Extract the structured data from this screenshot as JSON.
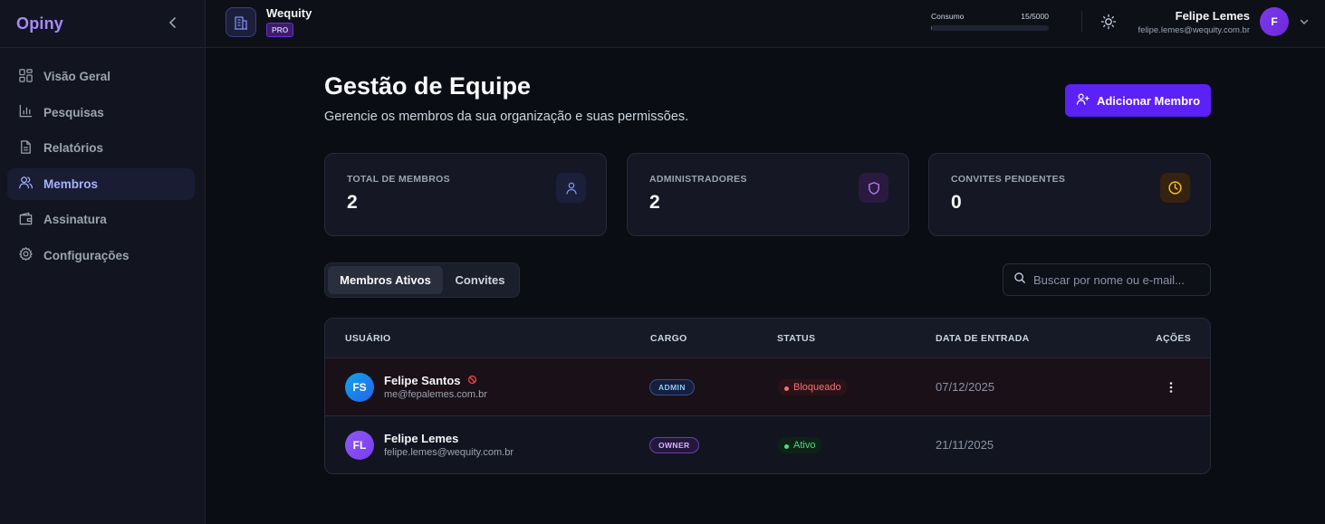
{
  "sidebar": {
    "logo": "Opiny",
    "items": [
      {
        "label": "Visão Geral",
        "icon": "dashboard-icon"
      },
      {
        "label": "Pesquisas",
        "icon": "bar-chart-icon"
      },
      {
        "label": "Relatórios",
        "icon": "document-icon"
      },
      {
        "label": "Membros",
        "icon": "users-icon",
        "active": true
      },
      {
        "label": "Assinatura",
        "icon": "wallet-icon"
      },
      {
        "label": "Configurações",
        "icon": "gear-icon"
      }
    ]
  },
  "topbar": {
    "workspace_name": "Wequity",
    "workspace_plan": "PRO",
    "usage_label": "Consumo",
    "usage_value": "15/5000",
    "usage_fraction": 0.003,
    "user_name": "Felipe Lemes",
    "user_email": "felipe.lemes@wequity.com.br",
    "user_initial": "F"
  },
  "page": {
    "title": "Gestão de Equipe",
    "subtitle": "Gerencie os membros da sua organização e suas permissões.",
    "add_button": "Adicionar Membro"
  },
  "stats": [
    {
      "label": "TOTAL DE MEMBROS",
      "value": "2",
      "icon": "user-icon",
      "color": "#6366f1"
    },
    {
      "label": "ADMINISTRADORES",
      "value": "2",
      "icon": "shield-icon",
      "color": "#a855f7"
    },
    {
      "label": "CONVITES PENDENTES",
      "value": "0",
      "icon": "clock-icon",
      "color": "#f59e0b"
    }
  ],
  "tabs": [
    "Membros Ativos",
    "Convites"
  ],
  "search": {
    "placeholder": "Buscar por nome ou e-mail..."
  },
  "table": {
    "headers": [
      "USUÁRIO",
      "CARGO",
      "STATUS",
      "DATA DE ENTRADA",
      "AÇÕES"
    ],
    "rows": [
      {
        "initials": "FS",
        "name": "Felipe Santos",
        "email": "me@fepalemes.com.br",
        "role": "ADMIN",
        "status": "Bloqueado",
        "date": "07/12/2025"
      },
      {
        "initials": "FL",
        "name": "Felipe Lemes",
        "email": "felipe.lemes@wequity.com.br",
        "role": "OWNER",
        "status": "Ativo",
        "date": "21/11/2025"
      }
    ]
  },
  "colors": {
    "accent": "#5b21f6",
    "brand": "#a78bfa",
    "blocked": "#f87171",
    "active": "#4ade80"
  }
}
